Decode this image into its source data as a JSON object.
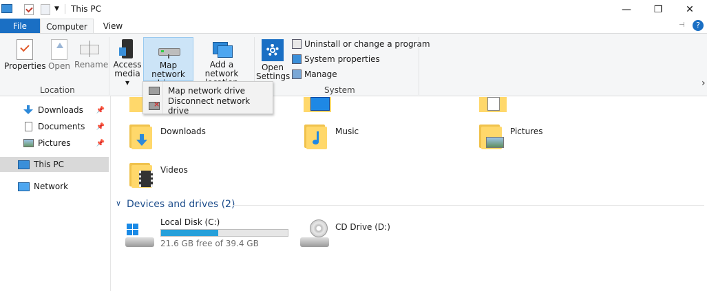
{
  "window": {
    "title": "This PC",
    "minimize_glyph": "—",
    "restore_glyph": "❐",
    "close_glyph": "✕"
  },
  "tabs": {
    "file": "File",
    "computer": "Computer",
    "view": "View"
  },
  "ribbon": {
    "location": {
      "label": "Location",
      "buttons": [
        "Properties",
        "Open",
        "Rename"
      ]
    },
    "network": {
      "access_media_1": "Access",
      "access_media_2": "media ▾",
      "map_drive_1": "Map network",
      "map_drive_2": "drive ▾",
      "add_location_1": "Add a network",
      "add_location_2": "location"
    },
    "system": {
      "label": "System",
      "open_settings_1": "Open",
      "open_settings_2": "Settings",
      "commands": [
        "Uninstall or change a program",
        "System properties",
        "Manage"
      ]
    }
  },
  "dropdown": {
    "items": [
      "Map network drive",
      "Disconnect network drive"
    ]
  },
  "nav": {
    "items": [
      {
        "label": "Downloads",
        "icon": "download-arrow-icon",
        "pinned": true
      },
      {
        "label": "Documents",
        "icon": "document-icon",
        "pinned": true
      },
      {
        "label": "Pictures",
        "icon": "pictures-icon",
        "pinned": true
      },
      {
        "label": "This PC",
        "icon": "computer-icon",
        "pinned": false
      },
      {
        "label": "Network",
        "icon": "network-icon",
        "pinned": false
      }
    ],
    "pin_glyph": "📌"
  },
  "folders": [
    {
      "name": "Downloads"
    },
    {
      "name": "Music"
    },
    {
      "name": "Pictures"
    },
    {
      "name": "Videos"
    }
  ],
  "devices": {
    "header": "Devices and drives (2)",
    "drives": [
      {
        "name": "Local Disk (C:)",
        "free_text": "21.6 GB free of 39.4 GB",
        "used_fraction": 0.452
      },
      {
        "name": "CD Drive (D:)"
      }
    ]
  },
  "colors": {
    "accent": "#1a6fc4",
    "disk_fill": "#26a0da",
    "folder": "#ffd86b",
    "selected_nav": "#d9d9d9"
  }
}
